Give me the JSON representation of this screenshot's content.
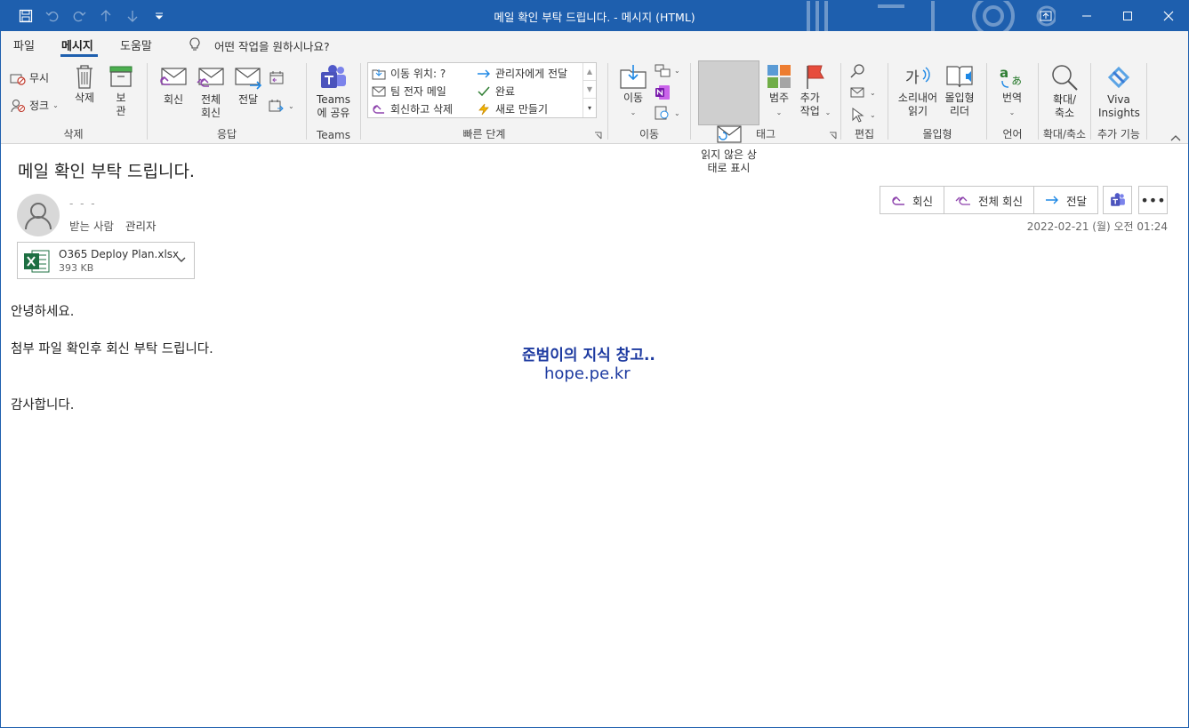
{
  "window": {
    "title": "메일 확인 부탁 드립니다.  -  메시지 (HTML)",
    "accent": "#1e5fae"
  },
  "menu": {
    "tabs": [
      "파일",
      "메시지",
      "도움말"
    ],
    "active_tab": "메시지",
    "tell_me": "어떤 작업을 원하시나요?"
  },
  "ribbon": {
    "delete_group": {
      "ignore": "무시",
      "junk": "정크",
      "delete": "삭제",
      "archive": "보관",
      "label": "삭제"
    },
    "respond_group": {
      "reply": "회신",
      "reply_all": "전체 회신",
      "forward": "전달",
      "label": "응답"
    },
    "teams_group": {
      "share": "Teams 에 공유",
      "label": "Teams"
    },
    "quick_steps": {
      "items": [
        "이동 위치: ?",
        "팀 전자 메일",
        "회신하고 삭제",
        "관리자에게 전달",
        "완료",
        "새로 만들기"
      ],
      "label": "빠른 단계"
    },
    "move_group": {
      "move": "이동",
      "label": "이동"
    },
    "tags_group": {
      "unread": "읽지 않은 상태로 표시",
      "categorize": "범주",
      "followup": "추가 작업",
      "label": "태그"
    },
    "edit_group": {
      "label": "편집"
    },
    "immersive_group": {
      "read_aloud": "소리내어 읽기",
      "immersive_reader": "몰입형 리더",
      "label": "몰입형"
    },
    "language_group": {
      "translate": "번역",
      "label": "언어"
    },
    "zoom_group": {
      "zoom": "확대/ 축소",
      "label": "확대/축소"
    },
    "addins_group": {
      "viva": "Viva Insights",
      "label": "추가 기능"
    }
  },
  "message": {
    "subject": "메일 확인 부탁 드립니다.",
    "sender": "- - -",
    "to_label": "받는 사람",
    "to_value": "관리자",
    "date": "2022-02-21 (월) 오전 01:24",
    "actions": {
      "reply": "회신",
      "reply_all": "전체 회신",
      "forward": "전달"
    },
    "attachment": {
      "name": "O365 Deploy Plan.xlsx",
      "size": "393 KB"
    },
    "body": [
      "안녕하세요.",
      "첨부 파일 확인후 회신 부탁 드립니다.",
      "감사합니다."
    ],
    "watermark": {
      "line1": "준범이의 지식 창고..",
      "line2": "hope.pe.kr"
    }
  }
}
